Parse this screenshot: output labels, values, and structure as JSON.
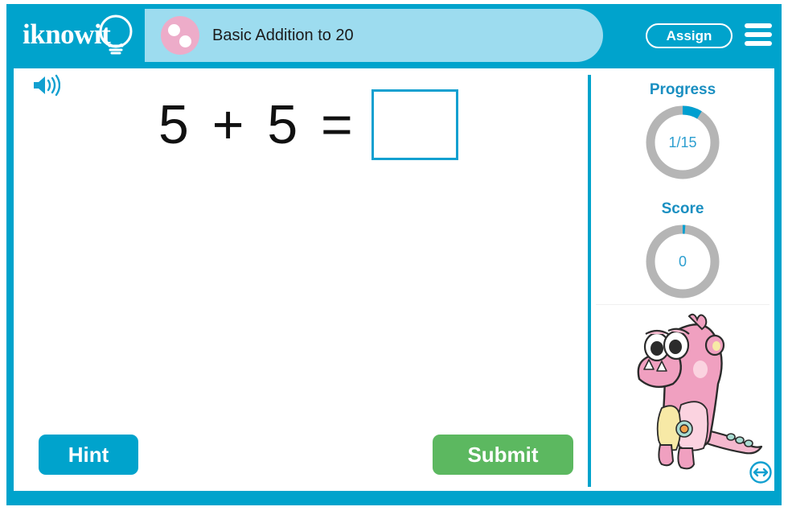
{
  "app": {
    "logo_text": "iknowit",
    "logo_icon": "lightbulb-icon"
  },
  "header": {
    "topic_badge_icon": "two-dots-circle-icon",
    "title": "Basic Addition to 20",
    "assign_label": "Assign",
    "menu_icon": "hamburger-menu-icon",
    "colors": {
      "bar": "#00a3cc",
      "title_pill": "#9ddcef",
      "badge": "#edacc9"
    }
  },
  "question": {
    "sound_icon": "speaker-icon",
    "equation": "5 + 5 =",
    "answer_value": "",
    "answer_placeholder": "",
    "hint_label": "Hint",
    "submit_label": "Submit",
    "colors": {
      "hint": "#00a3cc",
      "submit": "#5cb860",
      "answer_border": "#12a0d0"
    }
  },
  "sidebar": {
    "progress": {
      "label": "Progress",
      "value_text": "1/15",
      "current": 1,
      "total": 15,
      "percent": 6.7
    },
    "score": {
      "label": "Score",
      "value_text": "0",
      "value": 0,
      "percent": 0
    },
    "mascot_icon": "pink-monster-mascot",
    "resize_icon": "resize-horizontal-icon",
    "colors": {
      "accent": "#1a8fc1",
      "ring_track": "#b5b5b5",
      "ring_fill": "#009fd0"
    }
  }
}
